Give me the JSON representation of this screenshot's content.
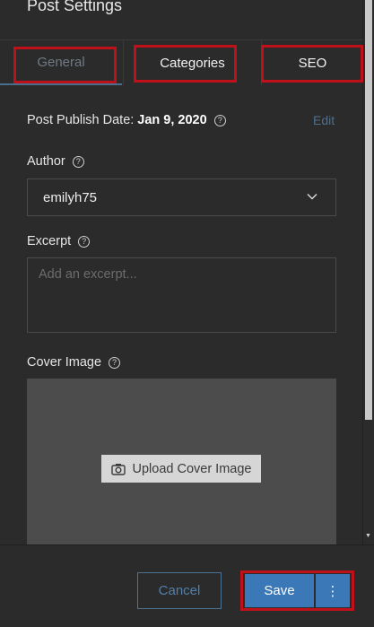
{
  "panel": {
    "title": "Post Settings"
  },
  "tabs": [
    {
      "label": "General"
    },
    {
      "label": "Categories"
    },
    {
      "label": "SEO"
    }
  ],
  "publish": {
    "label": "Post Publish Date:",
    "date": "Jan 9, 2020",
    "edit_label": "Edit"
  },
  "author": {
    "label": "Author",
    "value": "emilyh75"
  },
  "excerpt": {
    "label": "Excerpt",
    "placeholder": "Add an excerpt..."
  },
  "cover": {
    "label": "Cover Image",
    "upload_label": "Upload Cover Image"
  },
  "footer": {
    "cancel_label": "Cancel",
    "save_label": "Save",
    "more_label": "⋮"
  },
  "colors": {
    "accent": "#3a78b8",
    "highlight": "#c0101a",
    "background": "#2b2b2b"
  },
  "icons": [
    "help-icon",
    "chevron-down-icon",
    "camera-icon",
    "more-vertical-icon"
  ]
}
